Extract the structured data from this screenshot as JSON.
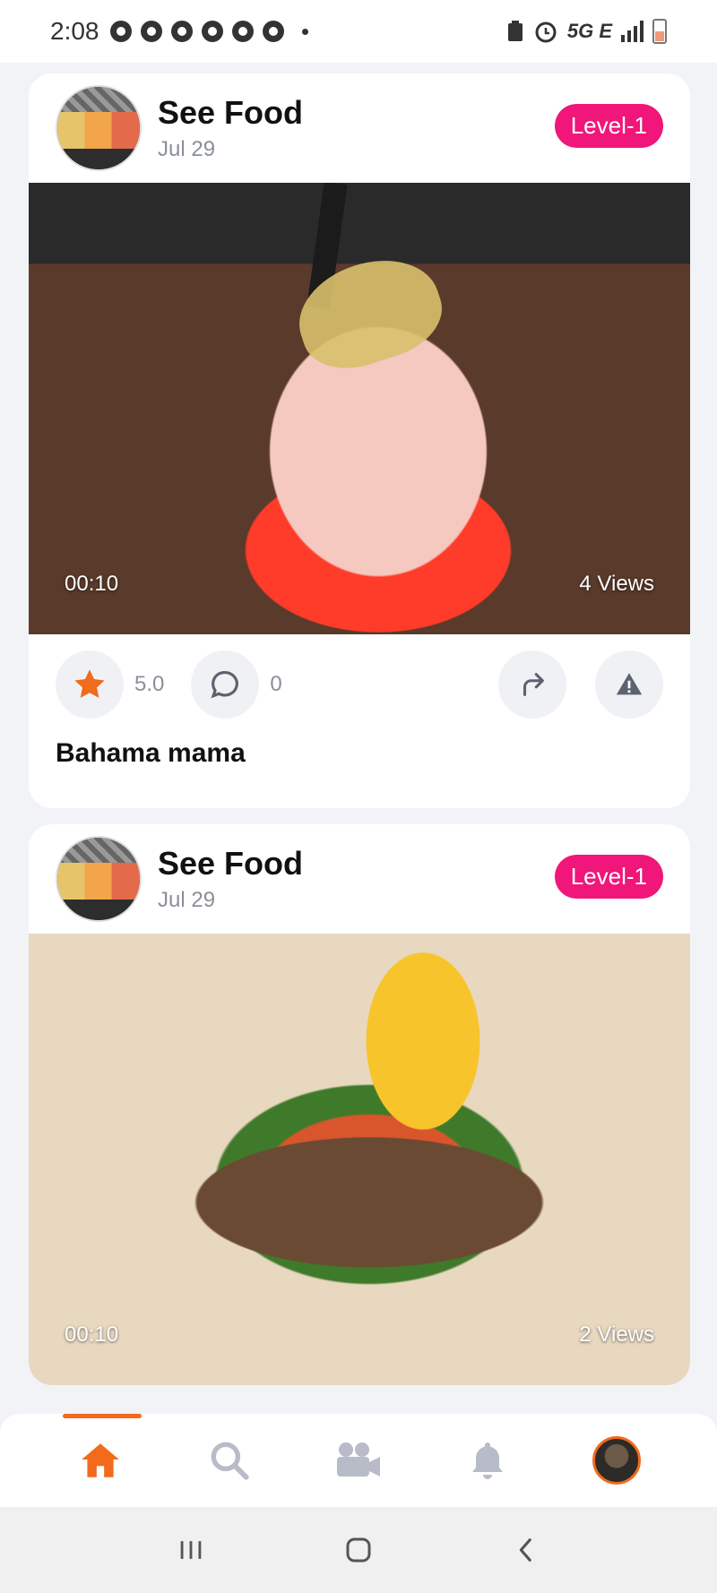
{
  "status_bar": {
    "time": "2:08",
    "network": "5G E"
  },
  "posts": [
    {
      "author": "See Food",
      "date": "Jul 29",
      "level": "Level-1",
      "duration": "00:10",
      "views": "4 Views",
      "rating": "5.0",
      "comments": "0",
      "caption": "Bahama mama"
    },
    {
      "author": "See Food",
      "date": "Jul 29",
      "level": "Level-1",
      "duration": "00:10",
      "views": "2 Views"
    }
  ],
  "colors": {
    "accent": "#f26a1b",
    "badge": "#f0167a",
    "icon_gray": "#b7bcc8"
  },
  "bottom_nav": {
    "items": [
      "home-icon",
      "search-icon",
      "video-camera-icon",
      "bell-icon",
      "profile-avatar"
    ],
    "active": "home-icon"
  }
}
